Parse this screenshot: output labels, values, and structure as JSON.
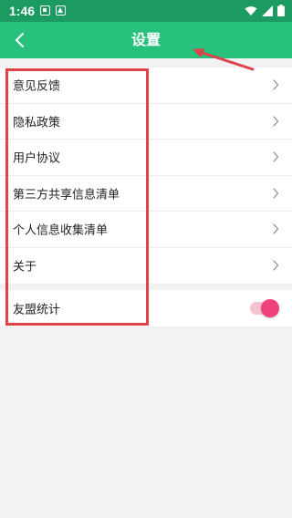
{
  "status_bar": {
    "time": "1:46",
    "left_icons": [
      "sim-icon",
      "notification-icon"
    ],
    "right_icons": [
      "wifi-icon",
      "signal-icon",
      "battery-icon"
    ]
  },
  "app_bar": {
    "title": "设置",
    "back_icon": "back-arrow-icon"
  },
  "settings": {
    "items": [
      {
        "label": "意见反馈"
      },
      {
        "label": "隐私政策"
      },
      {
        "label": "用户协议"
      },
      {
        "label": "第三方共享信息清单"
      },
      {
        "label": "个人信息收集清单"
      },
      {
        "label": "关于"
      }
    ],
    "toggle_item": {
      "label": "友盟统计",
      "enabled": true
    }
  },
  "colors": {
    "status_bar": "#1b9b61",
    "app_bar": "#27c07d",
    "page_bg": "#f2f2f4",
    "annotation": "#e0424a",
    "toggle_on": "#f0417a"
  }
}
